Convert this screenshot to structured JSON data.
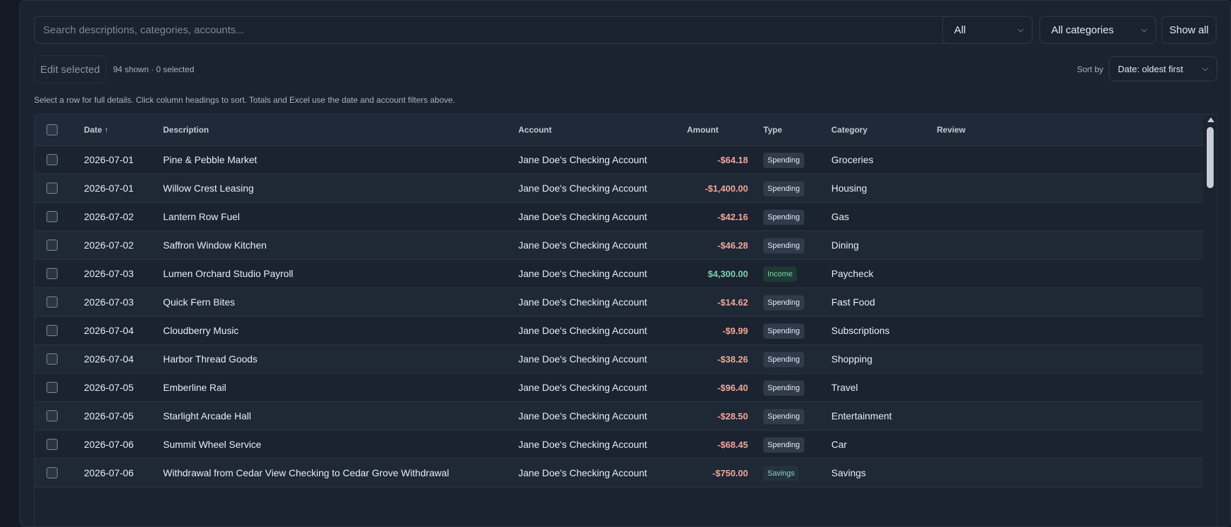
{
  "filters": {
    "search_placeholder": "Search descriptions, categories, accounts...",
    "type_value": "All",
    "category_value": "All categories",
    "show_all_label": "Show all"
  },
  "toolbar": {
    "edit_selected_label": "Edit selected",
    "counts_text": "94 shown · 0 selected",
    "sort_by_label": "Sort by",
    "sort_value": "Date: oldest first"
  },
  "hint_text": "Select a row for full details. Click column headings to sort. Totals and Excel use the date and account filters above.",
  "table": {
    "headers": {
      "date": "Date ↑",
      "description": "Description",
      "account": "Account",
      "amount": "Amount",
      "type": "Type",
      "category": "Category",
      "review": "Review"
    },
    "rows": [
      {
        "date": "2026-07-01",
        "description": "Pine & Pebble Market",
        "account": "Jane Doe's Checking Account",
        "amount": "-$64.18",
        "type": "Spending",
        "category": "Groceries"
      },
      {
        "date": "2026-07-01",
        "description": "Willow Crest Leasing",
        "account": "Jane Doe's Checking Account",
        "amount": "-$1,400.00",
        "type": "Spending",
        "category": "Housing"
      },
      {
        "date": "2026-07-02",
        "description": "Lantern Row Fuel",
        "account": "Jane Doe's Checking Account",
        "amount": "-$42.16",
        "type": "Spending",
        "category": "Gas"
      },
      {
        "date": "2026-07-02",
        "description": "Saffron Window Kitchen",
        "account": "Jane Doe's Checking Account",
        "amount": "-$46.28",
        "type": "Spending",
        "category": "Dining"
      },
      {
        "date": "2026-07-03",
        "description": "Lumen Orchard Studio Payroll",
        "account": "Jane Doe's Checking Account",
        "amount": "$4,300.00",
        "type": "Income",
        "category": "Paycheck"
      },
      {
        "date": "2026-07-03",
        "description": "Quick Fern Bites",
        "account": "Jane Doe's Checking Account",
        "amount": "-$14.62",
        "type": "Spending",
        "category": "Fast Food"
      },
      {
        "date": "2026-07-04",
        "description": "Cloudberry Music",
        "account": "Jane Doe's Checking Account",
        "amount": "-$9.99",
        "type": "Spending",
        "category": "Subscriptions"
      },
      {
        "date": "2026-07-04",
        "description": "Harbor Thread Goods",
        "account": "Jane Doe's Checking Account",
        "amount": "-$38.26",
        "type": "Spending",
        "category": "Shopping"
      },
      {
        "date": "2026-07-05",
        "description": "Emberline Rail",
        "account": "Jane Doe's Checking Account",
        "amount": "-$96.40",
        "type": "Spending",
        "category": "Travel"
      },
      {
        "date": "2026-07-05",
        "description": "Starlight Arcade Hall",
        "account": "Jane Doe's Checking Account",
        "amount": "-$28.50",
        "type": "Spending",
        "category": "Entertainment"
      },
      {
        "date": "2026-07-06",
        "description": "Summit Wheel Service",
        "account": "Jane Doe's Checking Account",
        "amount": "-$68.45",
        "type": "Spending",
        "category": "Car"
      },
      {
        "date": "2026-07-06",
        "description": "Withdrawal from Cedar View Checking to Cedar Grove Withdrawal",
        "account": "Jane Doe's Checking Account",
        "amount": "-$750.00",
        "type": "Savings",
        "category": "Savings"
      }
    ]
  },
  "colors": {
    "negative_amount": "#f1a89a",
    "positive_amount": "#7fd1b0",
    "background": "#1b2330"
  }
}
